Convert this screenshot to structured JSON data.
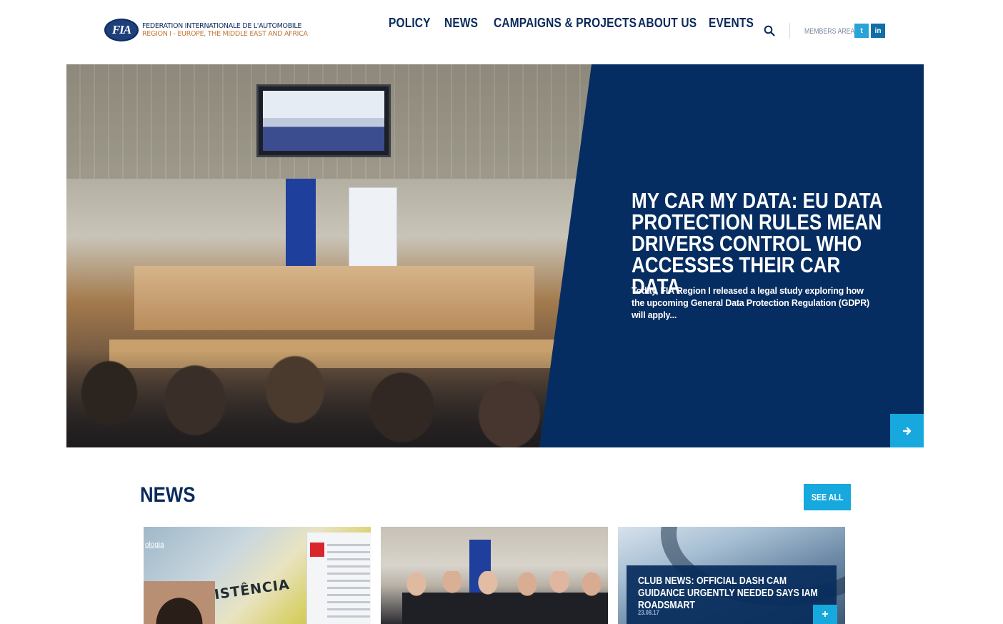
{
  "header": {
    "logo": {
      "mark": "FIA",
      "line1": "FEDERATION INTERNATIONALE DE L'AUTOMOBILE",
      "line2": "REGION I - EUROPE, THE MIDDLE EAST AND AFRICA"
    },
    "nav": [
      {
        "label": "POLICY"
      },
      {
        "label": "NEWS"
      },
      {
        "label": "CAMPAIGNS & PROJECTS"
      },
      {
        "label": "ABOUT US"
      },
      {
        "label": "EVENTS"
      }
    ],
    "members_label": "MEMBERS AREA",
    "social": {
      "twitter_glyph": "t",
      "linkedin_glyph": "in"
    }
  },
  "hero": {
    "title": "MY CAR MY DATA: EU DATA PROTECTION RULES MEAN DRIVERS CONTROL WHO ACCESSES THEIR CAR DATA",
    "excerpt": "Today, FIA Region I released a legal study exploring how the upcoming General Data Protection Regulation (GDPR) will apply...",
    "colors": {
      "panel": "#062d61",
      "accent": "#17a8dd"
    }
  },
  "news": {
    "heading": "NEWS",
    "see_all": "SEE ALL",
    "cards": [
      {
        "tag": "ologia",
        "photo_text": "SISTÊNCIA"
      },
      {},
      {
        "title": "CLUB NEWS: OFFICIAL DASH CAM GUIDANCE URGENTLY NEEDED SAYS IAM ROADSMART",
        "date": "23.08.17",
        "plus": "+"
      }
    ]
  }
}
